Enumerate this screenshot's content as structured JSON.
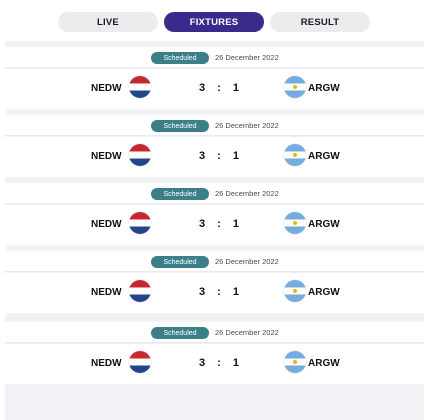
{
  "tabs": [
    {
      "label": "LIVE",
      "active": false
    },
    {
      "label": "FIXTURES",
      "active": true
    },
    {
      "label": "RESULT",
      "active": false
    }
  ],
  "colors": {
    "accent": "#3a2a8c",
    "badge": "#3b8088",
    "list_background": "#f2f2f6"
  },
  "matches": [
    {
      "status": "Scheduled",
      "date": "26 December 2022",
      "home": "NEDW",
      "home_flag": "netherlands-flag-icon",
      "home_score": "3",
      "separator": ":",
      "away_score": "1",
      "away": "ARGW",
      "away_flag": "argentina-flag-icon"
    },
    {
      "status": "Scheduled",
      "date": "26 December 2022",
      "home": "NEDW",
      "home_flag": "netherlands-flag-icon",
      "home_score": "3",
      "separator": ":",
      "away_score": "1",
      "away": "ARGW",
      "away_flag": "argentina-flag-icon"
    },
    {
      "status": "Scheduled",
      "date": "26 December 2022",
      "home": "NEDW",
      "home_flag": "netherlands-flag-icon",
      "home_score": "3",
      "separator": ":",
      "away_score": "1",
      "away": "ARGW",
      "away_flag": "argentina-flag-icon"
    },
    {
      "status": "Scheduled",
      "date": "26 December 2022",
      "home": "NEDW",
      "home_flag": "netherlands-flag-icon",
      "home_score": "3",
      "separator": ":",
      "away_score": "1",
      "away": "ARGW",
      "away_flag": "argentina-flag-icon"
    },
    {
      "status": "Scheduled",
      "date": "26 December 2022",
      "home": "NEDW",
      "home_flag": "netherlands-flag-icon",
      "home_score": "3",
      "separator": ":",
      "away_score": "1",
      "away": "ARGW",
      "away_flag": "argentina-flag-icon"
    }
  ]
}
